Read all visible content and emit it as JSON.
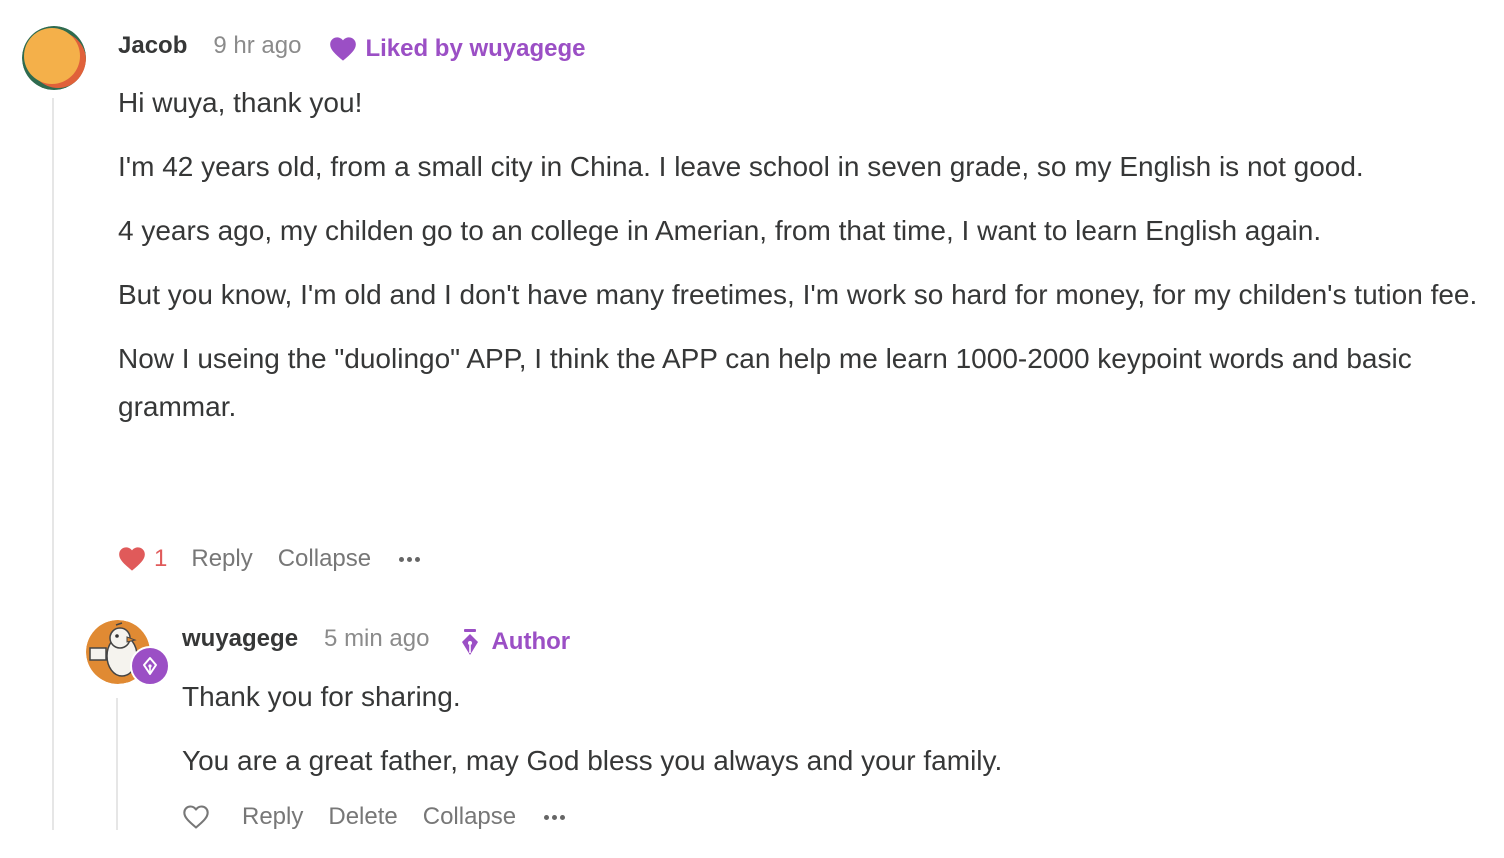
{
  "colors": {
    "accent_purple": "#9b4fc5",
    "like_red": "#e05a5a",
    "text": "#363737",
    "muted": "#8b8b8b"
  },
  "comments": [
    {
      "username": "Jacob",
      "time": "9 hr ago",
      "badge_icon": "heart-icon",
      "badge": "Liked by wuyagege",
      "paragraphs": [
        "Hi wuya, thank you!",
        "I'm 42 years old, from a small city in China. I leave school in seven grade, so my English is not good.",
        "4 years ago, my childen go to an college in Amerian, from that time, I want to learn English again.",
        "But you know, I'm old and I don't have many freetimes, I'm work so hard for money, for my childen's tution fee.",
        "Now I useing the \"duolingo\" APP, I think the APP can help me learn 1000-2000 keypoint words and basic grammar."
      ],
      "like_count": "1",
      "actions": {
        "reply": "Reply",
        "collapse": "Collapse"
      }
    },
    {
      "username": "wuyagege",
      "time": "5 min ago",
      "badge_icon": "pen-nib-icon",
      "badge": "Author",
      "paragraphs": [
        "Thank you for sharing.",
        "You are a great father, may God bless you always and your family."
      ],
      "actions": {
        "reply": "Reply",
        "delete": "Delete",
        "collapse": "Collapse"
      }
    }
  ]
}
